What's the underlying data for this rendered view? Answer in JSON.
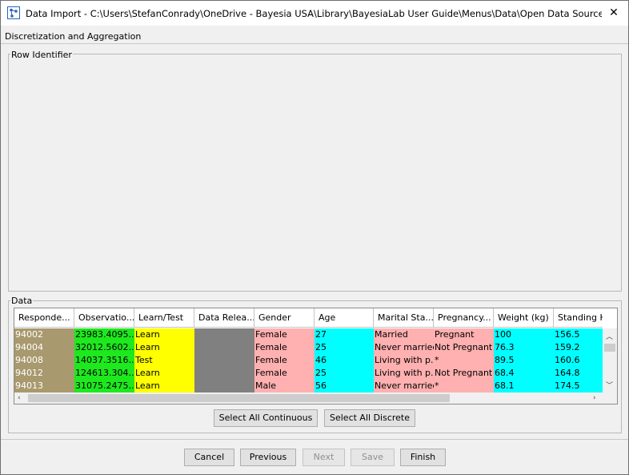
{
  "window": {
    "title": "Data Import - C:\\Users\\StefanConrady\\OneDrive - Bayesia USA\\Library\\BayesiaLab User Guide\\Menus\\Data\\Open Data Source\\Demo\\...",
    "close_symbol": "✕",
    "icon": "bayesialab-app-icon"
  },
  "menu": {
    "label": "Discretization and Aggregation"
  },
  "row_identifier": {
    "legend": "Row Identifier"
  },
  "data_section": {
    "legend": "Data",
    "columns": [
      "Responde...",
      "Observatio...",
      "Learn/Test",
      "Data Relea...",
      "Gender",
      "Age",
      "Marital Sta...",
      "Pregnancy...",
      "Weight (kg)",
      "Standing H"
    ],
    "rows": [
      [
        "94002",
        "23983.4095...",
        "Learn",
        "",
        "Female",
        "27",
        "Married",
        "Pregnant",
        "100",
        "156.5"
      ],
      [
        "94004",
        "32012.5602...",
        "Learn",
        "",
        "Female",
        "25",
        "Never married",
        "Not Pregnant",
        "76.3",
        "159.2"
      ],
      [
        "94008",
        "14037.3516...",
        "Test",
        "",
        "Female",
        "46",
        "Living with p...",
        "*",
        "89.5",
        "160.6"
      ],
      [
        "94012",
        "124613.304...",
        "Learn",
        "",
        "Female",
        "25",
        "Living with p...",
        "Not Pregnant",
        "68.4",
        "164.8"
      ],
      [
        "94013",
        "31075.2475...",
        "Learn",
        "",
        "Male",
        "56",
        "Never married",
        "*",
        "68.1",
        "174.5"
      ]
    ],
    "column_colors": [
      "#a8996e",
      "#1ee81e",
      "#ffff00",
      "#808080",
      "#ffb0b0",
      "#00ffff",
      "#ffb0b0",
      "#ffb0b0",
      "#00ffff",
      "#00ffff"
    ],
    "select_all_continuous": "Select All Continuous",
    "select_all_discrete": "Select All Discrete"
  },
  "footer": {
    "cancel": "Cancel",
    "previous": "Previous",
    "next": "Next",
    "save": "Save",
    "finish": "Finish"
  }
}
